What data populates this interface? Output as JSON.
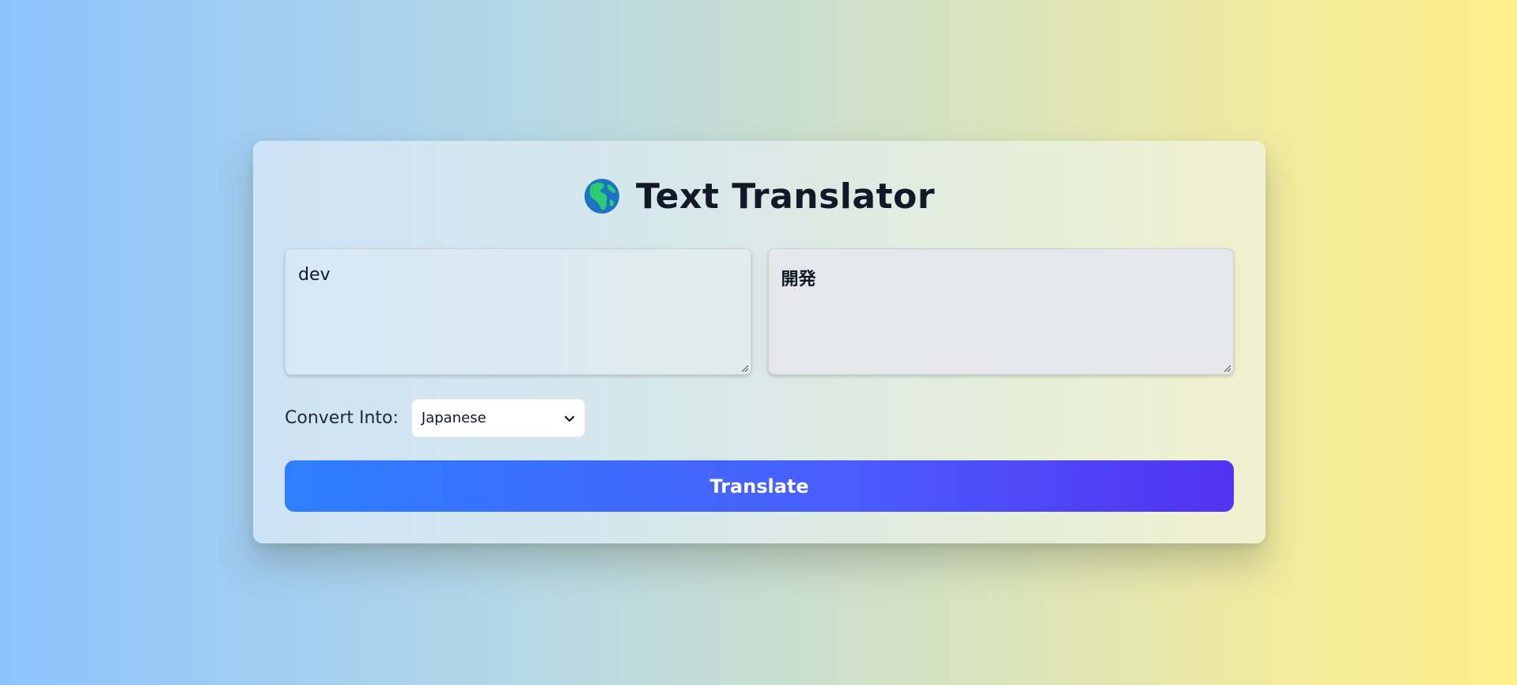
{
  "header": {
    "title": "Text Translator",
    "icon": "globe-icon"
  },
  "source": {
    "value": "dev"
  },
  "result": {
    "value": "開発"
  },
  "convert": {
    "label": "Convert Into:",
    "selected": "Japanese"
  },
  "actions": {
    "translate_label": "Translate"
  },
  "colors": {
    "button_start": "#2d7ffe",
    "button_end": "#5232f2",
    "title_text": "#111827",
    "output_bg": "#e5e7eb"
  }
}
